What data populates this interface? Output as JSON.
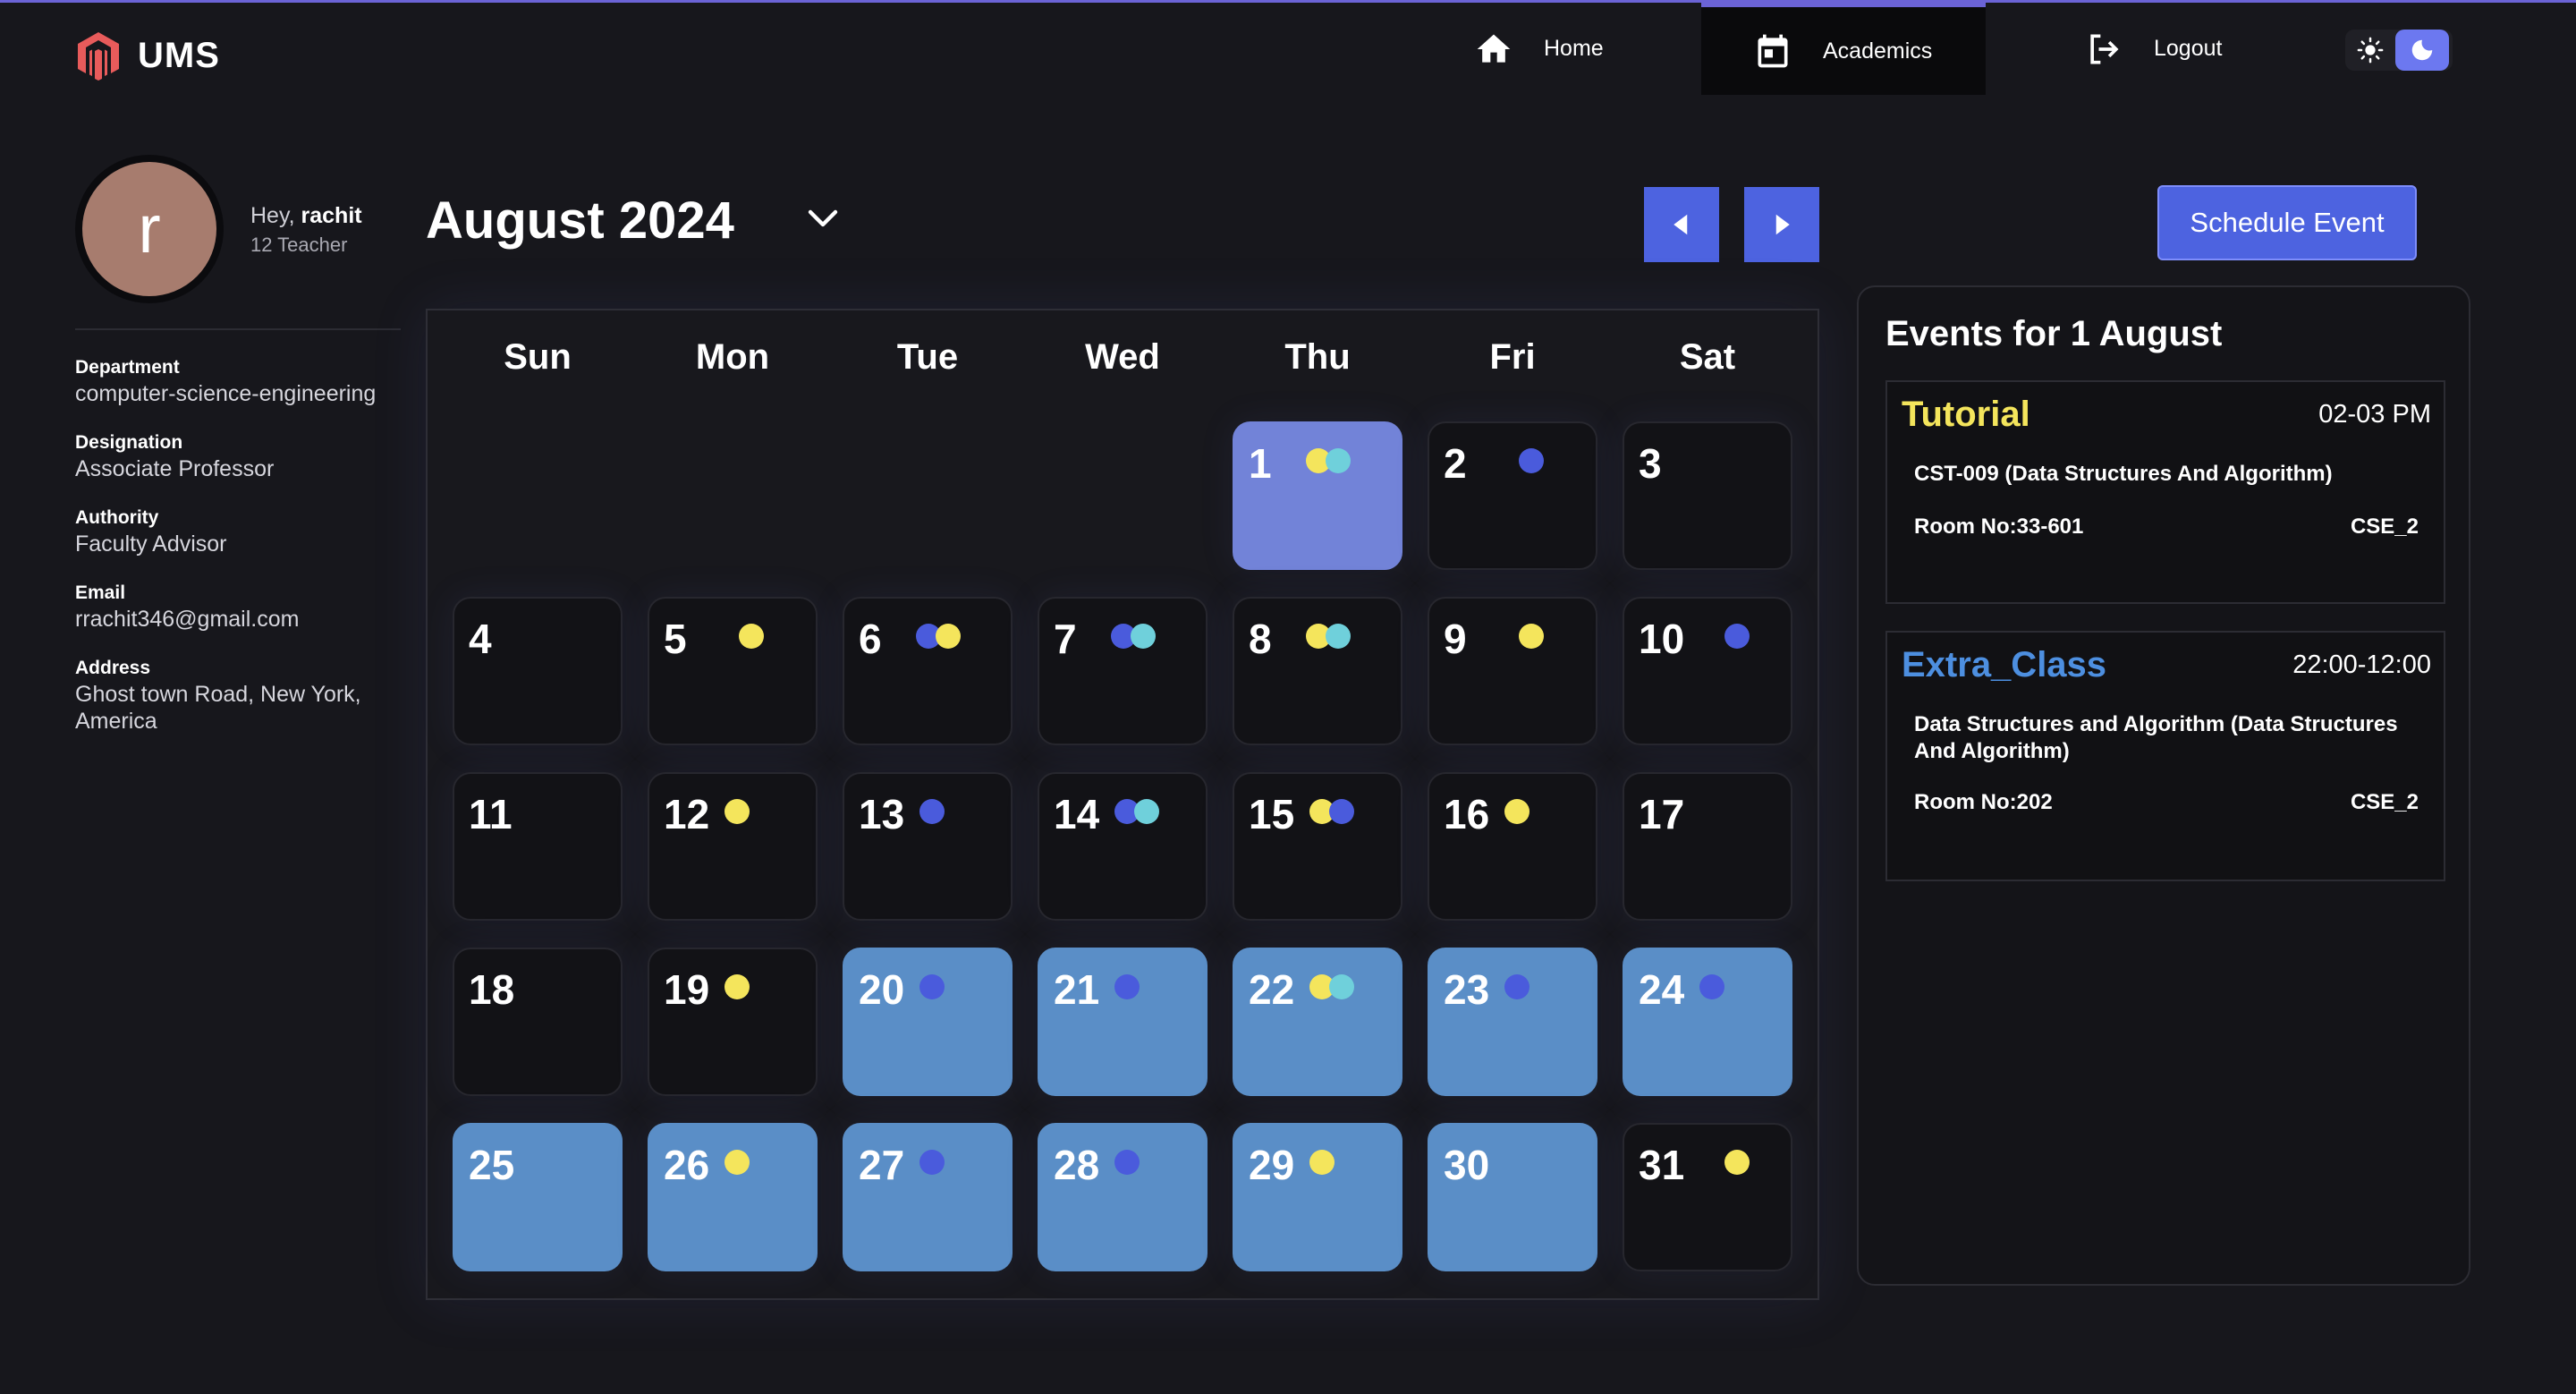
{
  "brand": {
    "name": "UMS"
  },
  "nav": {
    "home": "Home",
    "academics": "Academics",
    "logout": "Logout"
  },
  "profile": {
    "initial": "r",
    "greeting": "Hey,",
    "name": "rachit",
    "role": "12 Teacher",
    "fields": [
      {
        "label": "Department",
        "value": "computer-science-engineering"
      },
      {
        "label": "Designation",
        "value": "Associate Professor"
      },
      {
        "label": "Authority",
        "value": "Faculty Advisor"
      },
      {
        "label": "Email",
        "value": "rrachit346@gmail.com"
      },
      {
        "label": "Address",
        "value": "Ghost town Road, New York, America"
      }
    ]
  },
  "calendar": {
    "title": "August 2024",
    "weekdays": [
      "Sun",
      "Mon",
      "Tue",
      "Wed",
      "Thu",
      "Fri",
      "Sat"
    ],
    "first_weekday": 4,
    "selected_day": 1,
    "colors": {
      "yellow": "#f4e55c",
      "blue": "#4a5bdc",
      "cyan": "#6fd0db",
      "past": "#5a8ec7",
      "today": "#7283d8"
    },
    "days": [
      {
        "d": "1",
        "dots": [
          "yellow",
          "cyan"
        ],
        "state": "today"
      },
      {
        "d": "2",
        "dots": [
          "blue"
        ],
        "state": ""
      },
      {
        "d": "3",
        "dots": [],
        "state": ""
      },
      {
        "d": "4",
        "dots": [],
        "state": ""
      },
      {
        "d": "5",
        "dots": [
          "yellow"
        ],
        "state": ""
      },
      {
        "d": "6",
        "dots": [
          "blue",
          "yellow"
        ],
        "state": ""
      },
      {
        "d": "7",
        "dots": [
          "blue",
          "cyan"
        ],
        "state": ""
      },
      {
        "d": "8",
        "dots": [
          "yellow",
          "cyan"
        ],
        "state": ""
      },
      {
        "d": "9",
        "dots": [
          "yellow"
        ],
        "state": ""
      },
      {
        "d": "10",
        "dots": [
          "blue"
        ],
        "state": ""
      },
      {
        "d": "11",
        "dots": [],
        "state": ""
      },
      {
        "d": "12",
        "dots": [
          "yellow"
        ],
        "state": ""
      },
      {
        "d": "13",
        "dots": [
          "blue"
        ],
        "state": ""
      },
      {
        "d": "14",
        "dots": [
          "blue",
          "cyan"
        ],
        "state": ""
      },
      {
        "d": "15",
        "dots": [
          "yellow",
          "blue"
        ],
        "state": ""
      },
      {
        "d": "16",
        "dots": [
          "yellow"
        ],
        "state": ""
      },
      {
        "d": "17",
        "dots": [],
        "state": ""
      },
      {
        "d": "18",
        "dots": [],
        "state": ""
      },
      {
        "d": "19",
        "dots": [
          "yellow"
        ],
        "state": ""
      },
      {
        "d": "20",
        "dots": [
          "blue"
        ],
        "state": "past"
      },
      {
        "d": "21",
        "dots": [
          "blue"
        ],
        "state": "past"
      },
      {
        "d": "22",
        "dots": [
          "yellow",
          "cyan"
        ],
        "state": "past"
      },
      {
        "d": "23",
        "dots": [
          "blue"
        ],
        "state": "past"
      },
      {
        "d": "24",
        "dots": [
          "blue"
        ],
        "state": "past"
      },
      {
        "d": "25",
        "dots": [],
        "state": "past"
      },
      {
        "d": "26",
        "dots": [
          "yellow"
        ],
        "state": "past"
      },
      {
        "d": "27",
        "dots": [
          "blue"
        ],
        "state": "past"
      },
      {
        "d": "28",
        "dots": [
          "blue"
        ],
        "state": "past"
      },
      {
        "d": "29",
        "dots": [
          "yellow"
        ],
        "state": "past"
      },
      {
        "d": "30",
        "dots": [],
        "state": "past"
      },
      {
        "d": "31",
        "dots": [
          "yellow"
        ],
        "state": ""
      }
    ]
  },
  "actions": {
    "schedule": "Schedule Event"
  },
  "events_panel": {
    "title": "Events for 1 August",
    "events": [
      {
        "type": "Tutorial",
        "type_color": "#f4e55c",
        "time": "02-03 PM",
        "subject": "CST-009 (Data Structures And Algorithm)",
        "room": "Room No:33-601",
        "section": "CSE_2"
      },
      {
        "type": "Extra_Class",
        "type_color": "#4d8fe0",
        "time": "22:00-12:00",
        "subject": "Data Structures and Algorithm (Data Structures And Algorithm)",
        "room": "Room No:202",
        "section": "CSE_2"
      }
    ]
  }
}
